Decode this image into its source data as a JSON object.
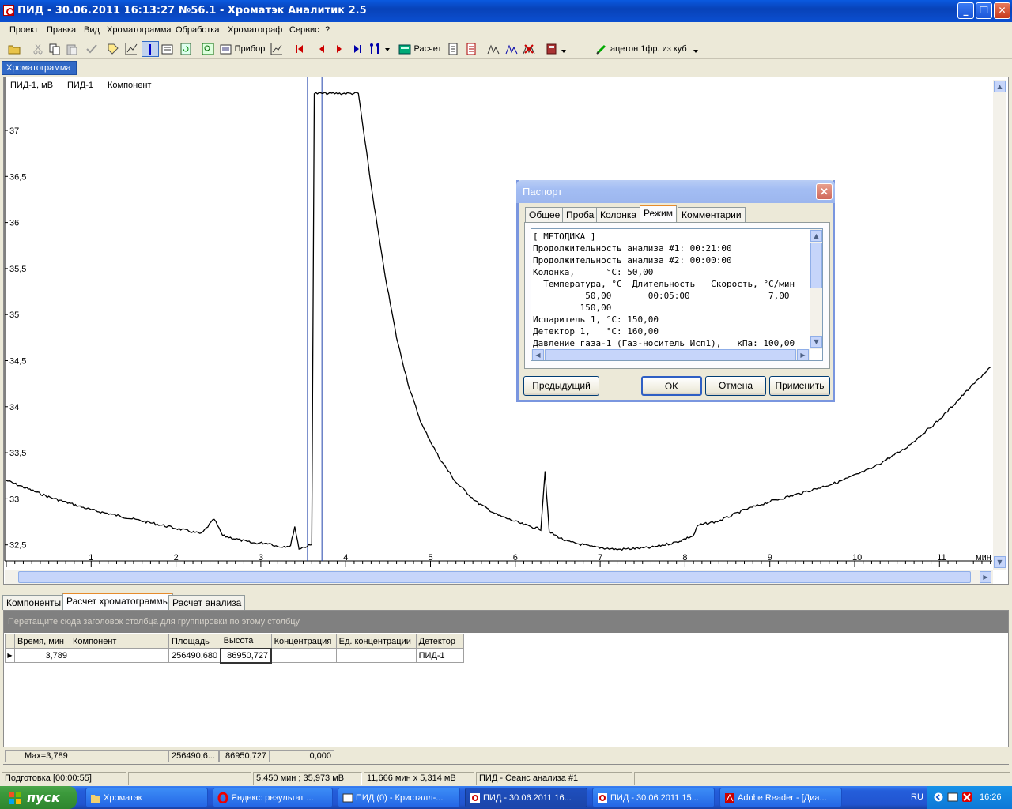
{
  "window": {
    "title": "ПИД - 30.06.2011 16:13:27 №56.1 - Хроматэк Аналитик 2.5"
  },
  "menu": [
    "Проект",
    "Правка",
    "Вид",
    "Хроматограмма",
    "Обработка",
    "Хроматограф",
    "Сервис",
    "?"
  ],
  "toolbar": {
    "instrument_label": "Прибор",
    "calc_label": "Расчет",
    "method_label": "ацетон 1фр. из куб"
  },
  "doc_tab": "Хроматограмма",
  "chart_header": {
    "ylabel": "ПИД-1, мВ",
    "detector": "ПИД-1",
    "component": "Компонент",
    "xunit": "мин"
  },
  "chart_data": {
    "type": "line",
    "x_ticks": [
      "1",
      "2",
      "3",
      "4",
      "5",
      "6",
      "7",
      "8",
      "9",
      "10",
      "11"
    ],
    "y_ticks": [
      "37",
      "36,5",
      "36",
      "35,5",
      "35",
      "34,5",
      "34",
      "33,5",
      "33",
      "32,5"
    ],
    "xlim": [
      0,
      11.6
    ],
    "ylim": [
      32.33,
      37.4
    ],
    "series": [
      {
        "points": [
          [
            0,
            33.2
          ],
          [
            0.5,
            33.02
          ],
          [
            1,
            32.88
          ],
          [
            1.5,
            32.78
          ],
          [
            2,
            32.68
          ],
          [
            2.3,
            32.62
          ],
          [
            2.45,
            32.78
          ],
          [
            2.55,
            32.6
          ],
          [
            2.9,
            32.52
          ],
          [
            3.1,
            32.52
          ],
          [
            3.2,
            32.48
          ],
          [
            3.35,
            32.49
          ],
          [
            3.4,
            32.7
          ],
          [
            3.45,
            32.46
          ],
          [
            3.6,
            32.5
          ],
          [
            3.63,
            37.4
          ],
          [
            4.15,
            37.4
          ],
          [
            4.3,
            36.4
          ],
          [
            4.45,
            35.5
          ],
          [
            4.6,
            34.75
          ],
          [
            4.75,
            34.2
          ],
          [
            4.9,
            33.8
          ],
          [
            5.1,
            33.45
          ],
          [
            5.3,
            33.18
          ],
          [
            5.55,
            32.96
          ],
          [
            5.8,
            32.82
          ],
          [
            6.1,
            32.72
          ],
          [
            6.3,
            32.67
          ],
          [
            6.35,
            33.3
          ],
          [
            6.4,
            32.64
          ],
          [
            6.6,
            32.54
          ],
          [
            6.9,
            32.48
          ],
          [
            7.2,
            32.45
          ],
          [
            7.6,
            32.47
          ],
          [
            7.9,
            32.53
          ],
          [
            8.1,
            32.6
          ],
          [
            8.15,
            32.71
          ],
          [
            8.4,
            32.76
          ],
          [
            8.7,
            32.88
          ],
          [
            9,
            32.97
          ],
          [
            9.4,
            33.07
          ],
          [
            9.8,
            33.18
          ],
          [
            10.2,
            33.33
          ],
          [
            10.6,
            33.55
          ],
          [
            11,
            33.86
          ],
          [
            11.3,
            34.15
          ],
          [
            11.6,
            34.43
          ]
        ]
      }
    ],
    "markers": [
      {
        "x": 3.55
      },
      {
        "x": 3.72
      }
    ]
  },
  "bottom_tabs": [
    "Компоненты",
    "Расчет хроматограммы",
    "Расчет анализа"
  ],
  "grid": {
    "group_hint": "Перетащите сюда заголовок столбца для группировки по этому столбцу",
    "columns": [
      "Время, мин",
      "Компонент",
      "Площадь",
      "Высота",
      "Концентрация",
      "Ед. концентрации",
      "Детектор"
    ],
    "rows": [
      [
        "3,789",
        "",
        "256490,680",
        "86950,727",
        "",
        "",
        "ПИД-1"
      ]
    ],
    "summary": {
      "time": "Max=3,789",
      "area": "256490,6...",
      "height": "86950,727",
      "conc": "0,000"
    }
  },
  "statusbar": [
    "Подготовка [00:00:55]",
    "",
    "5,450 мин ; 35,973 мВ",
    "11,666 мин x 5,314 мВ",
    "ПИД - Сеанс анализа #1"
  ],
  "dialog": {
    "title": "Паспорт",
    "tabs": [
      "Общее",
      "Проба",
      "Колонка",
      "Режим",
      "Комментарии"
    ],
    "text": "[ МЕТОДИКА ]\nПродолжительность анализа #1: 00:21:00\nПродолжительность анализа #2: 00:00:00\nКолонка,      °С: 50,00\n  Температура, °С  Длительность   Скорость, °С/мин\n          50,00       00:05:00               7,00\n         150,00\nИспаритель 1, °С: 150,00\nДетектор 1,   °С: 160,00\nДавление газа-1 (Газ-носитель Исп1),   кПа: 100,00",
    "buttons": {
      "prev": "Предыдущий",
      "ok": "OK",
      "cancel": "Отмена",
      "apply": "Применить"
    }
  },
  "taskbar": {
    "start": "пуск",
    "items": [
      "Хроматэк",
      "Яндекс: результат ...",
      "ПИД (0) - Кристалл-...",
      "ПИД - 30.06.2011 16...",
      "ПИД - 30.06.2011 15...",
      "Adobe Reader - [Диа..."
    ],
    "lang": "RU",
    "clock": "16:26"
  }
}
